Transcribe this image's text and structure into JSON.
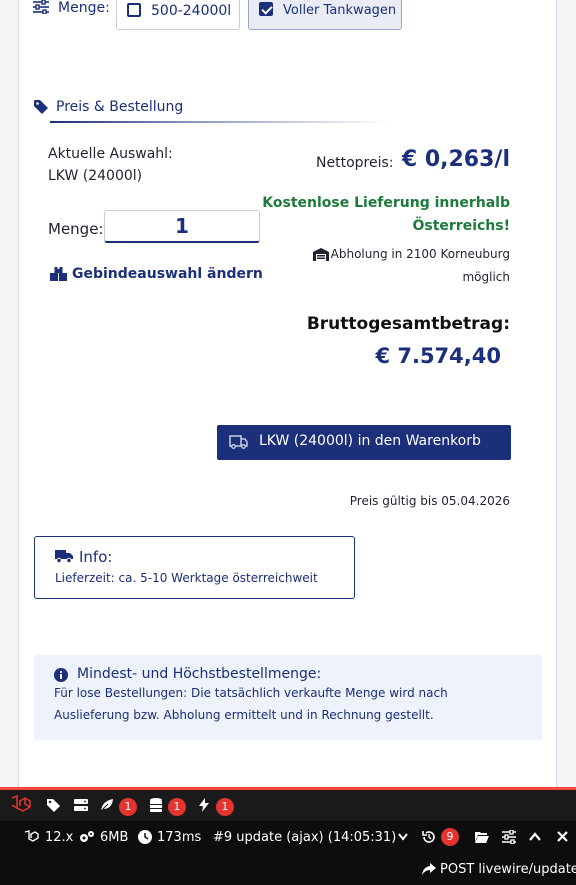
{
  "quantity_filter": {
    "label": "Menge:",
    "options": [
      {
        "label": "500-24000l",
        "checked": false
      },
      {
        "label": "Voller Tankwagen",
        "checked": true
      }
    ]
  },
  "section": {
    "title": "Preis & Bestellung"
  },
  "selection": {
    "current_label": "Aktuelle Auswahl:",
    "current_value": "LKW (24000l)",
    "qty_label": "Menge:",
    "qty_value": "1",
    "change_link": "Gebindeauswahl ändern"
  },
  "pricing": {
    "net_label": "Nettopreis:",
    "net_value": "€ 0,263/l",
    "free_delivery_line1": "Kostenlose Lieferung innerhalb",
    "free_delivery_line2": "Österreichs!",
    "pickup_line1": "Abholung in 2100 Korneuburg",
    "pickup_line2": "möglich",
    "gross_label": "Bruttogesamtbetrag:",
    "gross_value": "€ 7.574,40",
    "cart_button": "LKW (24000l) in den Warenkorb",
    "valid_until": "Preis gültig bis 05.04.2026"
  },
  "info": {
    "title": "Info:",
    "text": "Lieferzeit: ca. 5-10 Werktage österreichweit"
  },
  "min_max": {
    "title": "Mindest- und Höchstbestellmenge:",
    "line1": "Für lose Bestellungen: Die tatsächlich verkaufte Menge wird nach",
    "line2": "Auslieferung bzw. Abholung ermittelt und in Rechnung gestellt."
  },
  "debugbar": {
    "badges": [
      "1",
      "1",
      "1"
    ],
    "laravel_version": "12.x",
    "memory": "6MB",
    "time": "173ms",
    "request": "#9 update (ajax) (14:05:31)",
    "history_count": "9",
    "route": "POST livewire/update"
  },
  "colors": {
    "primary": "#1b2f7a",
    "green": "#1d7a3b",
    "debug_red": "#e3342f"
  }
}
